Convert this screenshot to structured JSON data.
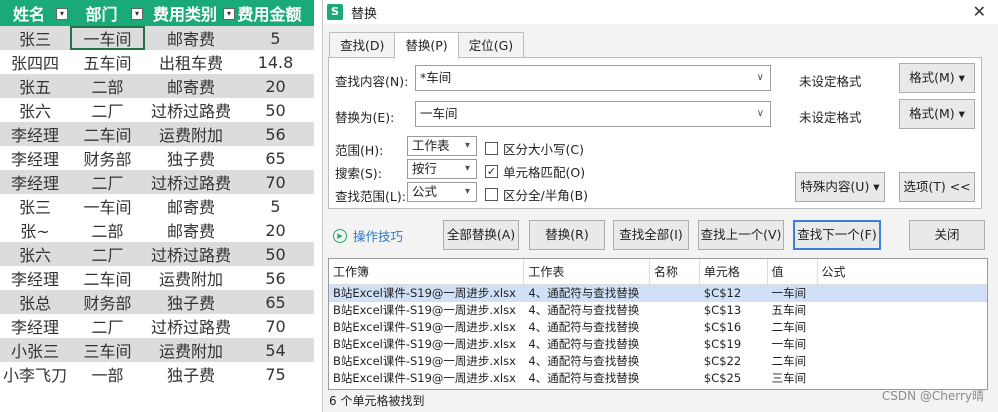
{
  "sheet": {
    "headers": [
      "姓名",
      "部门",
      "费用类别",
      "费用金额"
    ],
    "filter_icon": "filter-dropdown-icon",
    "rows": [
      [
        "张三",
        "一车间",
        "邮寄费",
        "5"
      ],
      [
        "张四四",
        "五车间",
        "出租车费",
        "14.8"
      ],
      [
        "张五",
        "二部",
        "邮寄费",
        "20"
      ],
      [
        "张六",
        "二厂",
        "过桥过路费",
        "50"
      ],
      [
        "李经理",
        "二车间",
        "运费附加",
        "56"
      ],
      [
        "李经理",
        "财务部",
        "独子费",
        "65"
      ],
      [
        "李经理",
        "二厂",
        "过桥过路费",
        "70"
      ],
      [
        "张三",
        "一车间",
        "邮寄费",
        "5"
      ],
      [
        "张~",
        "二部",
        "邮寄费",
        "20"
      ],
      [
        "张六",
        "二厂",
        "过桥过路费",
        "50"
      ],
      [
        "李经理",
        "二车间",
        "运费附加",
        "56"
      ],
      [
        "张总",
        "财务部",
        "独子费",
        "65"
      ],
      [
        "李经理",
        "二厂",
        "过桥过路费",
        "70"
      ],
      [
        "小张三",
        "三车间",
        "运费附加",
        "54"
      ],
      [
        "小李飞刀",
        "一部",
        "独子费",
        "75"
      ]
    ],
    "header_color": "#1aaa7a",
    "shade_color": "#dcdcdc",
    "active_cell_color": "#217346"
  },
  "dialog": {
    "app_icon": "S",
    "title": "替换",
    "close": "✕",
    "tabs": [
      "查找(D)",
      "替换(P)",
      "定位(G)"
    ],
    "find_label": "查找内容(N):",
    "find_value": "*车间",
    "replace_label": "替换为(E):",
    "replace_value": "一车间",
    "no_format_1": "未设定格式",
    "no_format_2": "未设定格式",
    "format_btn_1": "格式(M)",
    "format_btn_2": "格式(M)",
    "scope_label": "范围(H):",
    "scope_value": "工作表",
    "search_label": "搜索(S):",
    "search_value": "按行",
    "lookin_label": "查找范围(L):",
    "lookin_value": "公式",
    "opt_case": "区分大小写(C)",
    "opt_case_checked": false,
    "opt_whole": "单元格匹配(O)",
    "opt_whole_checked": true,
    "opt_width": "区分全/半角(B)",
    "opt_width_checked": false,
    "special_btn": "特殊内容(U)",
    "options_btn": "选项(T) <<",
    "tips": "操作技巧",
    "replace_all_btn": "全部替换(A)",
    "replace_btn": "替换(R)",
    "find_all_btn": "查找全部(I)",
    "find_prev_btn": "查找上一个(V)",
    "find_next_btn": "查找下一个(F)",
    "close_btn": "关闭",
    "accent_color": "#3c7fd6",
    "results": {
      "columns": [
        "工作簿",
        "工作表",
        "名称",
        "单元格",
        "值",
        "公式"
      ],
      "rows": [
        [
          "B站Excel课件-S19@一周进步.xlsx",
          "4、通配符与查找替换",
          "",
          "$C$12",
          "一车间",
          ""
        ],
        [
          "B站Excel课件-S19@一周进步.xlsx",
          "4、通配符与查找替换",
          "",
          "$C$13",
          "五车间",
          ""
        ],
        [
          "B站Excel课件-S19@一周进步.xlsx",
          "4、通配符与查找替换",
          "",
          "$C$16",
          "二车间",
          ""
        ],
        [
          "B站Excel课件-S19@一周进步.xlsx",
          "4、通配符与查找替换",
          "",
          "$C$19",
          "一车间",
          ""
        ],
        [
          "B站Excel课件-S19@一周进步.xlsx",
          "4、通配符与查找替换",
          "",
          "$C$22",
          "二车间",
          ""
        ],
        [
          "B站Excel课件-S19@一周进步.xlsx",
          "4、通配符与查找替换",
          "",
          "$C$25",
          "三车间",
          ""
        ]
      ],
      "selected_color": "#cfe0f7"
    },
    "status": "6 个单元格被找到"
  },
  "watermark": "CSDN @Cherry晴"
}
